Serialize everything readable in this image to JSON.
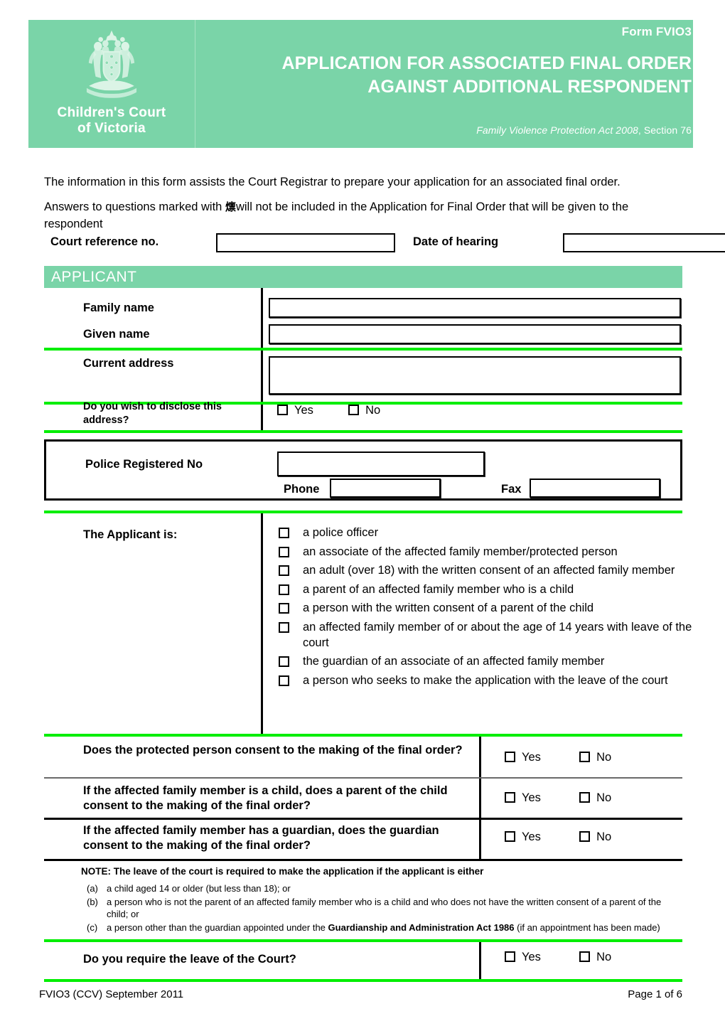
{
  "header": {
    "form_code": "Form FVIO3",
    "title_line1": "APPLICATION FOR ASSOCIATED FINAL ORDER",
    "title_line2": "AGAINST ADDITIONAL RESPONDENT",
    "act_italic": "Family Violence Protection Act 2008",
    "act_rest": ", Section 76",
    "logo_line1": "Children's Court",
    "logo_line2": "of Victoria",
    "crest_icon": "victoria-coat-of-arms-icon",
    "band_color": "#7ad4a8",
    "text_color": "#ffffff"
  },
  "intro": {
    "paragraph1": "The information in this form assists the Court Registrar to prepare your application for an associated final order.",
    "paragraph2_before": "Answers to questions marked with ",
    "paragraph2_glyph": "燷",
    "paragraph2_after": "will not be included in the Application for Final Order that will be given to the respondent"
  },
  "reference_row": {
    "court_reference_label": "Court reference no.",
    "court_reference_value": "",
    "date_of_hearing_label": "Date of hearing",
    "date_of_hearing_value": ""
  },
  "section": {
    "applicant_banner": "APPLICANT"
  },
  "applicant": {
    "family_name_label": "Family name",
    "family_name_value": "",
    "given_name_label": "Given name",
    "given_name_value": "",
    "current_address_label": "Current address",
    "current_address_value": "",
    "disclose_label": "Do you wish to disclose this address?",
    "disclose_yes": "Yes",
    "disclose_no": "No",
    "police_registered_label": "Police Registered No",
    "police_registered_value": "",
    "phone_label": "Phone",
    "phone_value": "",
    "fax_label": "Fax",
    "fax_value": "",
    "applicant_is_label": "The Applicant is:",
    "applicant_is_options": [
      "a police officer",
      "an associate of the affected family member/protected person",
      "an adult (over 18) with the written consent of an affected family member",
      "a parent of an affected family member who is a child",
      "a person with the written consent of a parent of the child",
      "an affected family member of or about the age of 14 years with leave of the court",
      "the guardian of an associate of an affected family member",
      "a person who seeks to make the application with the leave of the court"
    ]
  },
  "consent_questions": [
    {
      "question": "Does the protected person consent to the making of the final order?",
      "yes": "Yes",
      "no": "No"
    },
    {
      "question": "If the affected family member is a child, does a parent of the child consent to the making of the final order?",
      "yes": "Yes",
      "no": "No"
    },
    {
      "question": "If the affected family member has a guardian, does the guardian consent to the making of the final order?",
      "yes": "Yes",
      "no": "No"
    }
  ],
  "note": {
    "heading_bold": "NOTE: The leave of the court is required to make the application",
    "heading_rest": " if the applicant is either",
    "items": [
      {
        "mark": "(a)",
        "text_a": "a child aged 14 or older (but less than 18); or",
        "bold": "",
        "text_b": ""
      },
      {
        "mark": "(b)",
        "text_a": "a person who is not the parent of an affected family member who is a child and who does not have the written consent of a parent of the child; or",
        "bold": "",
        "text_b": ""
      },
      {
        "mark": "(c)",
        "text_a": "a person other than the guardian appointed under the ",
        "bold": "Guardianship and Administration Act 1986",
        "text_b": " (if an appointment has been made)"
      }
    ]
  },
  "leave_question": {
    "question": "Do you require the leave of the Court?",
    "yes": "Yes",
    "no": "No"
  },
  "footer": {
    "left": "FVIO3 (CCV) September 2011",
    "right": "Page 1 of 6"
  },
  "colors": {
    "banner_green": "#7ad4a8",
    "rule_green": "#00ee00",
    "ink": "#000000"
  }
}
